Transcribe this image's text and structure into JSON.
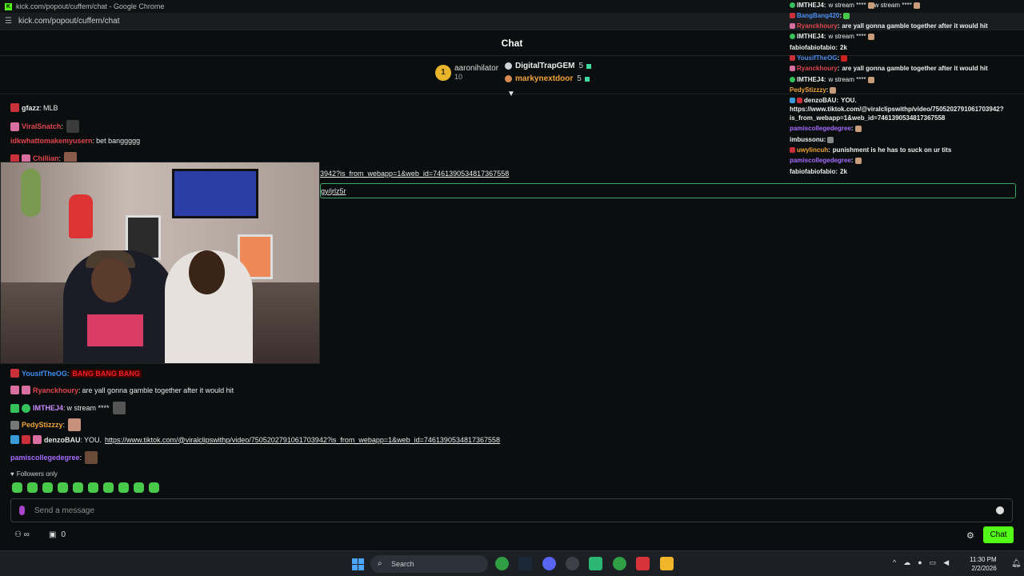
{
  "browser": {
    "window_title": "kick.com/popout/cuffem/chat - Google Chrome",
    "url": "kick.com/popout/cuffem/chat"
  },
  "chat_header": {
    "title": "Chat"
  },
  "leaderboard": {
    "first": {
      "rank": "1",
      "name": "aaronihilator",
      "count": "10"
    },
    "second": {
      "name": "DigitalTrapGEM",
      "count": "5"
    },
    "third": {
      "name": "markynextdoor",
      "count": "5"
    }
  },
  "messages": [
    {
      "user": "gfazz",
      "sep": ":",
      "text": "MLB",
      "color": "#e6e6e6"
    },
    {
      "user": "ViralSnatch",
      "sep": ":",
      "text": "",
      "color": "#e0454e"
    },
    {
      "user": "idkwhattomakemyusern",
      "sep": ":",
      "text": "bet banggggg",
      "color": "#e0454e"
    },
    {
      "user": "Chillian",
      "sep": ":",
      "text": "",
      "color": "#e0454e"
    },
    {
      "user": "YousifTheOG",
      "sep": ":",
      "text": "BANG BANG BANG",
      "color": "#3f8ef0"
    },
    {
      "user": "Ryanckhoury",
      "sep": ":",
      "text": "are yall gonna gamble together after it would hit",
      "color": "#e0454e"
    },
    {
      "user": "IMTHEJ4",
      "sep": ":",
      "text": "w stream ****",
      "color": "#c98cff"
    },
    {
      "user": "PedyStizzzy",
      "sep": ":",
      "text": "",
      "color": "#f0a33a"
    },
    {
      "user": "denzoBAU",
      "sep": ":",
      "text": "YOU.",
      "link": "https://www.tiktok.com/@viralclipswithp/video/7505202791061703942?is_from_webapp=1&web_id=7461390534817367558",
      "color": "#e6e6e6"
    },
    {
      "user": "pamiscollegedegree",
      "sep": ":",
      "text": "",
      "color": "#a66cff"
    }
  ],
  "overflow": {
    "line1": "3942?is_from_webapp=1&web_id=7461390534817367558",
    "line2": "gy/jrlz5r"
  },
  "followers_only": "Followers only",
  "send_placeholder": "Send a message",
  "bottom": {
    "count": "0",
    "chat_button": "Chat"
  },
  "taskbar": {
    "search": "Search",
    "time": "11:30 PM",
    "date": "2/2/2026"
  },
  "overlay": [
    {
      "user": "IMTHEJ4",
      "text": "w stream ****",
      "tail": "w stream ****",
      "color": "#ffffff"
    },
    {
      "user": "BangBang420",
      "text": "",
      "color": "#4a8df0"
    },
    {
      "user": "Ryanckhoury",
      "text": "are yall gonna gamble together after it would hit",
      "color": "#e0454e"
    },
    {
      "user": "IMTHEJ4",
      "text": "w stream ****",
      "color": "#ffffff"
    },
    {
      "user": "fabiofabiofabio",
      "text": "2k",
      "color": "#ffffff"
    },
    {
      "user": "YousifTheOG",
      "text": "",
      "color": "#4a8df0"
    },
    {
      "user": "Ryanckhoury",
      "text": "are yall gonna gamble together after it would hit",
      "color": "#e0454e"
    },
    {
      "user": "IMTHEJ4",
      "text": "w stream ****",
      "color": "#ffffff"
    },
    {
      "user": "PedyStizzzy",
      "text": "",
      "color": "#f0a33a"
    },
    {
      "user": "denzoBAU",
      "text": "YOU.",
      "color": "#ffffff"
    },
    {
      "user": "",
      "text": "https://www.tiktok.com/@viralclipswithp/video/7505202791061703942?",
      "color": "#ffffff"
    },
    {
      "user": "",
      "text": "is_from_webapp=1&web_id=7461390534817367558",
      "color": "#ffffff"
    },
    {
      "user": "pamiscollegedegree",
      "text": "",
      "color": "#a66cff"
    },
    {
      "user": "imbussonu",
      "text": "",
      "color": "#ffffff"
    },
    {
      "user": "uwylincuh",
      "text": "punishment is he has to suck on ur tits",
      "color": "#f0a33a"
    },
    {
      "user": "pamiscollegedegree",
      "text": "",
      "color": "#a66cff"
    },
    {
      "user": "fabiofabiofabio",
      "text": "2k",
      "color": "#ffffff"
    }
  ]
}
